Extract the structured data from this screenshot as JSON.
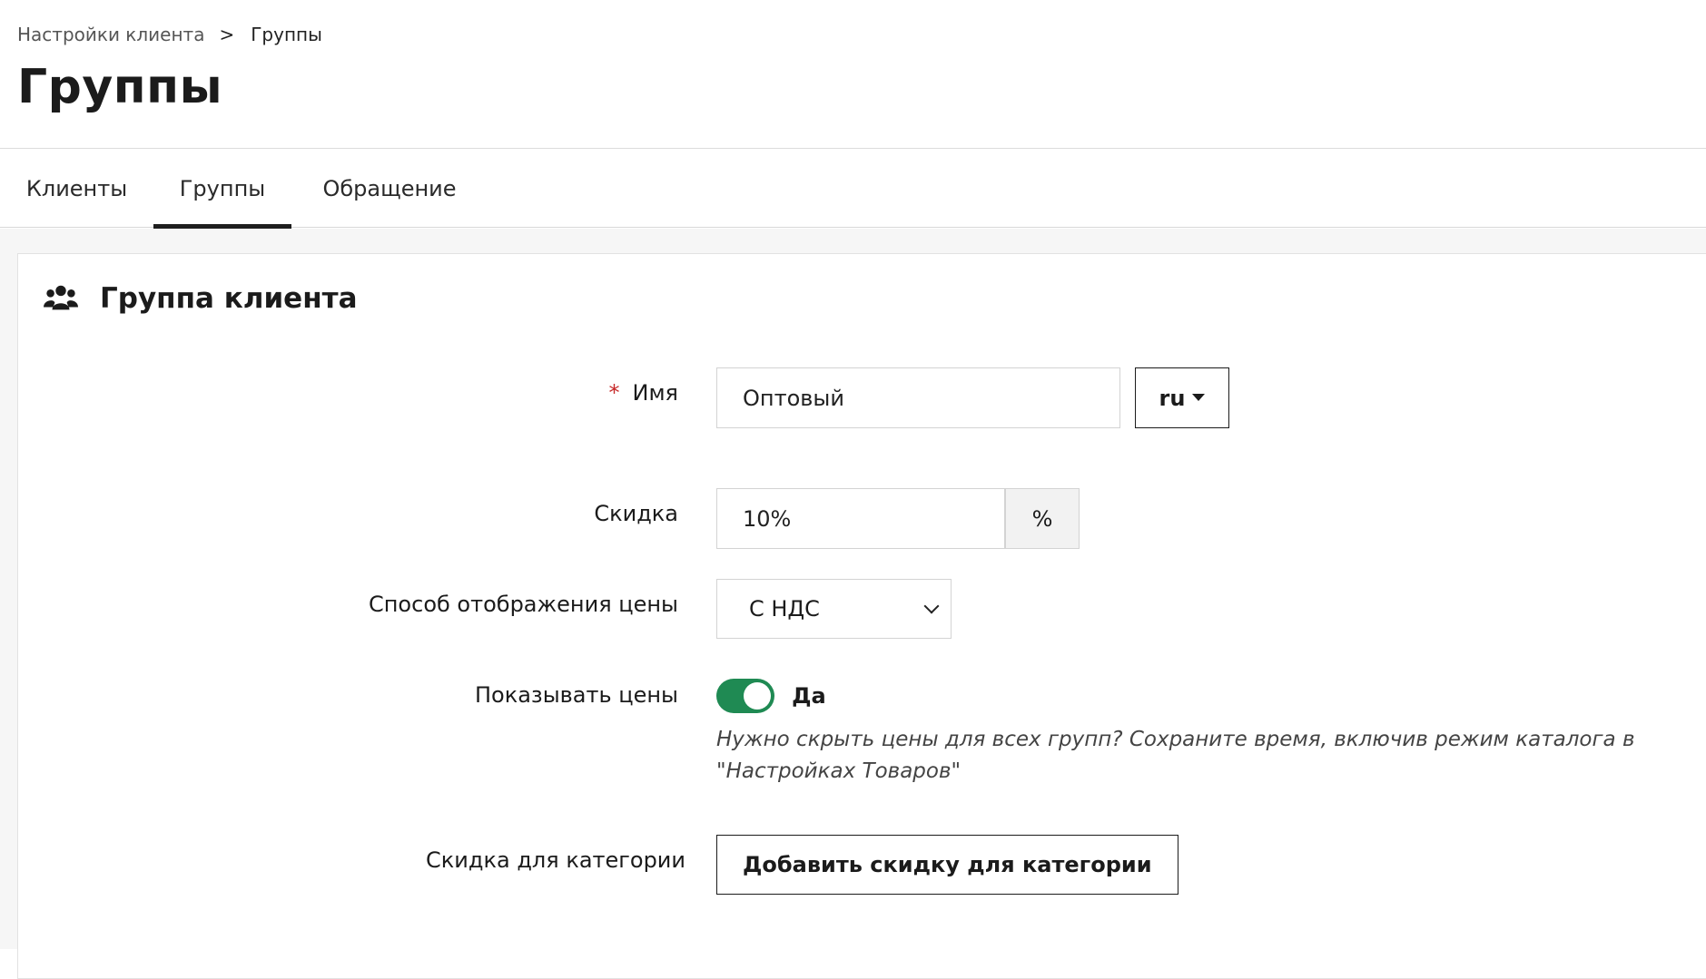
{
  "breadcrumb": {
    "parent": "Настройки клиента",
    "separator": ">",
    "current": "Группы"
  },
  "page_title": "Группы",
  "tabs": [
    {
      "label": "Клиенты",
      "active": false
    },
    {
      "label": "Группы",
      "active": true
    },
    {
      "label": "Обращение",
      "active": false
    }
  ],
  "card": {
    "icon": "users-icon",
    "title": "Группа клиента"
  },
  "form": {
    "name": {
      "required_mark": "*",
      "label": "Имя",
      "value": "Оптовый",
      "lang": "ru"
    },
    "discount": {
      "label": "Скидка",
      "value": "10%",
      "unit": "%"
    },
    "price_display": {
      "label": "Способ отображения цены",
      "value": "С НДС"
    },
    "show_prices": {
      "label": "Показывать цены",
      "enabled": true,
      "state_text": "Да",
      "hint": "Нужно скрыть цены для всех групп? Сохраните время, включив режим каталога в \"Настройках Товаров\""
    },
    "category_discount": {
      "label": "Скидка для категории",
      "button": "Добавить скидку для категории"
    }
  },
  "colors": {
    "toggle_on": "#1f8a53",
    "required": "#c62828"
  }
}
